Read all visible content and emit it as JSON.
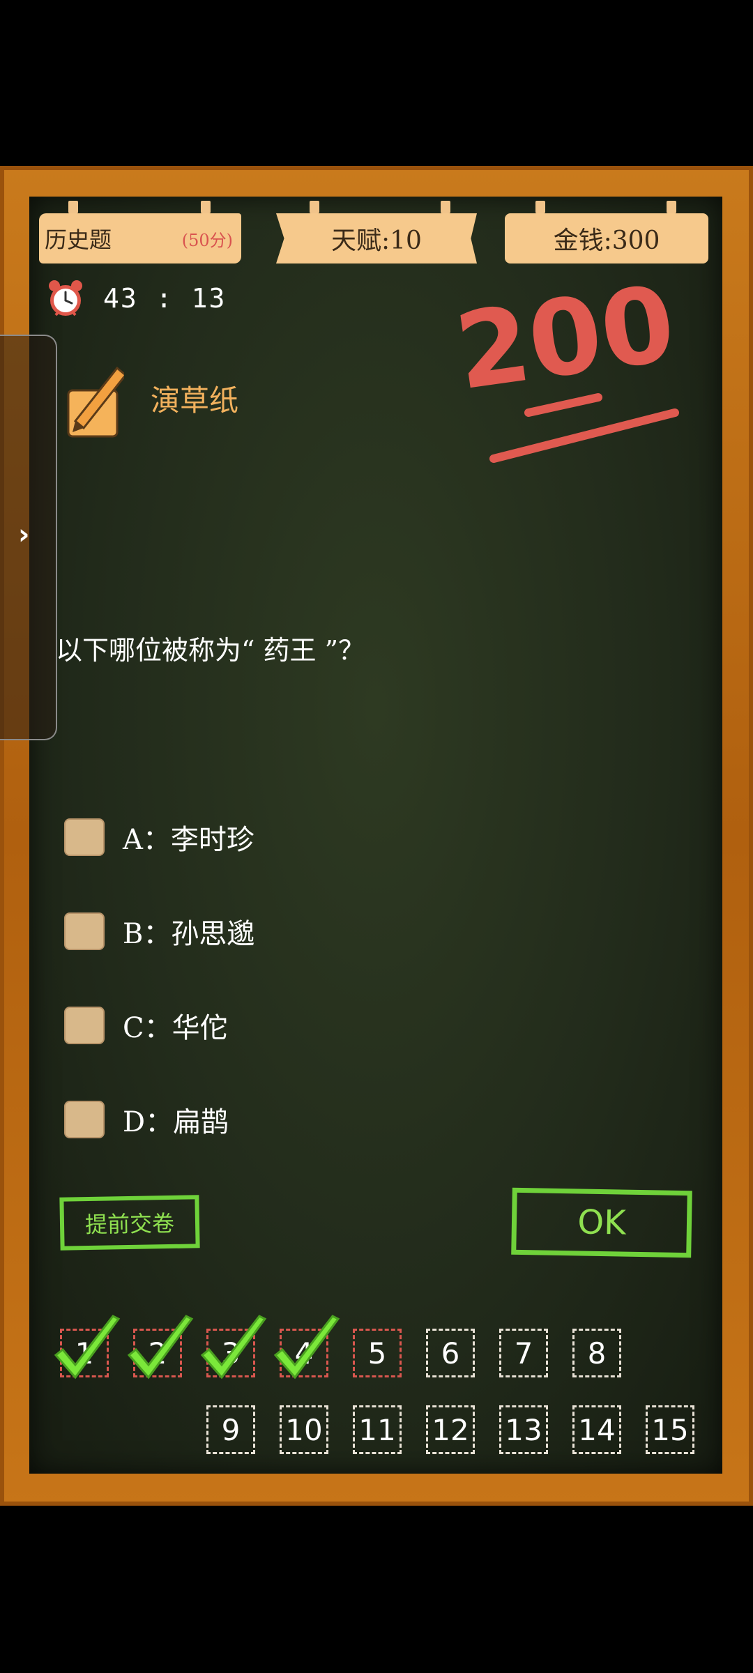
{
  "header": {
    "subject_label": "历史题",
    "subject_score": "(50分)",
    "talent_label": "天赋:10",
    "money_label": "金钱:300"
  },
  "timer": {
    "minutes": "43",
    "separator": ":",
    "seconds": "13",
    "icon": "alarm-clock-icon"
  },
  "score_display": "200",
  "scratch_paper": {
    "label": "演草纸",
    "icon": "pencil-note-icon"
  },
  "side_drawer": {
    "icon": "chevron-right-icon"
  },
  "question": {
    "text": "以下哪位被称为“ 药王 ”？"
  },
  "options": [
    {
      "label": "A：李时珍"
    },
    {
      "label": "B：孙思邈"
    },
    {
      "label": "C：华佗"
    },
    {
      "label": "D：扁鹊"
    }
  ],
  "buttons": {
    "submit_early": "提前交卷",
    "ok": "OK"
  },
  "question_numbers": [
    {
      "n": "1",
      "state": "answered"
    },
    {
      "n": "2",
      "state": "answered"
    },
    {
      "n": "3",
      "state": "answered"
    },
    {
      "n": "4",
      "state": "answered"
    },
    {
      "n": "5",
      "state": "current"
    },
    {
      "n": "6",
      "state": "pending"
    },
    {
      "n": "7",
      "state": "pending"
    },
    {
      "n": "8",
      "state": "pending"
    },
    {
      "n": "9",
      "state": "pending"
    },
    {
      "n": "10",
      "state": "pending"
    },
    {
      "n": "11",
      "state": "pending"
    },
    {
      "n": "12",
      "state": "pending"
    },
    {
      "n": "13",
      "state": "pending"
    },
    {
      "n": "14",
      "state": "pending"
    },
    {
      "n": "15",
      "state": "pending"
    }
  ],
  "colors": {
    "frame": "#b8660f",
    "board": "#222b1b",
    "plank": "#f6c98c",
    "accent_green": "#6fd23a",
    "accent_red": "#d9574f",
    "score_red": "#e05a50",
    "scratch_label": "#f2b15d"
  }
}
